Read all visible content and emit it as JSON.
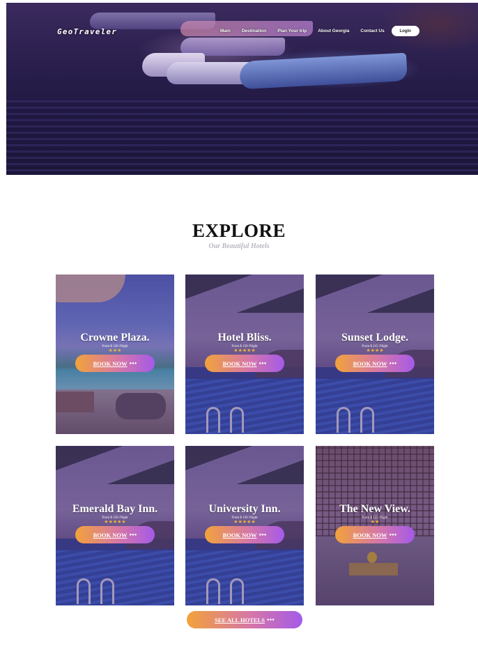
{
  "header": {
    "logo": "GeoTraveler",
    "nav": [
      "Main",
      "Destination",
      "Plan Your trip",
      "About Georgia",
      "Contact Us"
    ],
    "login_label": "Login"
  },
  "section": {
    "title": "EXPLORE",
    "subtitle": "Our Beautiful Hotels"
  },
  "hotels": [
    {
      "name": "Crowne Plaza.",
      "price": "From $ 120 /Night",
      "stars": "★★★",
      "rating": 3
    },
    {
      "name": "Hotel Bliss.",
      "price": "From $ 150 /Night",
      "stars": "★★★★★",
      "rating": 5
    },
    {
      "name": "Sunset Lodge.",
      "price": "From $ 215 /Night",
      "stars": "★★★★",
      "rating": 4
    },
    {
      "name": "Emerald Bay Inn.",
      "price": "From $ 150 /Night",
      "stars": "★★★★★",
      "rating": 5
    },
    {
      "name": "University Inn.",
      "price": "From $ 150 /Night",
      "stars": "★★★★★",
      "rating": 5
    },
    {
      "name": "The New View.",
      "price": "From $ 125 /Night",
      "stars": "★★",
      "rating": 2
    }
  ],
  "buttons": {
    "book_now": "BOOK NOW",
    "see_all": "SEE ALL HOTELS",
    "dots": "●●●"
  },
  "colors": {
    "button_gradient_start": "#f2a23a",
    "button_gradient_end": "#a45ae8",
    "star": "#f0b43a"
  }
}
